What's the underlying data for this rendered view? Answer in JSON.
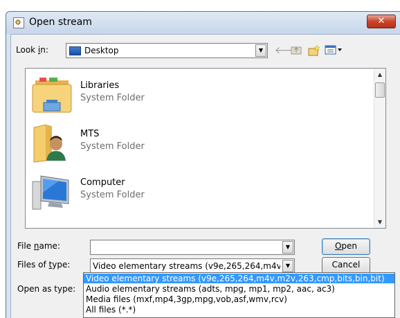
{
  "window": {
    "title": "Open stream",
    "close_icon": "close-icon"
  },
  "lookin": {
    "label_pre": "Look ",
    "label_ul": "i",
    "label_post": "n:",
    "value": "Desktop"
  },
  "toolbar": {
    "icons": [
      "back-arrow-icon",
      "up-folder-icon",
      "new-folder-icon",
      "view-menu-icon"
    ]
  },
  "files": [
    {
      "name": "Libraries",
      "type": "System Folder",
      "icon": "libraries-icon"
    },
    {
      "name": "MTS",
      "type": "System Folder",
      "icon": "user-folder-icon"
    },
    {
      "name": "Computer",
      "type": "System Folder",
      "icon": "computer-icon"
    }
  ],
  "filename": {
    "label_pre": "File ",
    "label_ul": "n",
    "label_post": "ame:",
    "value": ""
  },
  "filetype": {
    "label_pre": "Files of ",
    "label_ul": "t",
    "label_post": "ype:",
    "value": "Video elementary streams (v9e,265,264,m4v"
  },
  "openas": {
    "label": "Open as type:"
  },
  "buttons": {
    "open_ul": "O",
    "open_rest": "pen",
    "cancel": "Cancel"
  },
  "type_options": [
    "Video elementary streams (v9e,265,264,m4v,m2v,263,cmp,bits,bin,bit)",
    "Audio elementary streams (adts, mpg, mp1, mp2, aac, ac3)",
    "Media files (mxf,mp4,3gp,mpg,vob,asf,wmv,rcv)",
    "All files (*.*)"
  ]
}
